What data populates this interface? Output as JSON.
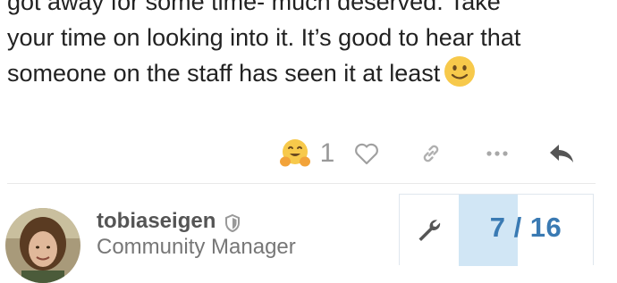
{
  "post": {
    "lines": [
      "got away for some time- much deserved. Take",
      "your time on looking into it. It’s good to hear that",
      "someone on the staff has seen it at least"
    ],
    "trailing_emoji": "slightly-smiling-face-icon"
  },
  "actions": {
    "reaction_emoji": "hugging-face-icon",
    "reaction_count": "1",
    "like_icon": "heart-icon",
    "link_icon": "link-icon",
    "more_icon": "ellipsis-icon",
    "reply_icon": "reply-icon"
  },
  "next_post": {
    "username": "tobiaseigen",
    "user_badge_icon": "shield-icon",
    "user_title": "Community Manager"
  },
  "timeline": {
    "admin_icon": "wrench-icon",
    "position_label": "7 / 16",
    "progress": 0.4375
  },
  "colors": {
    "text": "#222222",
    "muted": "#999999",
    "accent": "#3a7ab3",
    "progress_fill": "#d1e6f5"
  }
}
